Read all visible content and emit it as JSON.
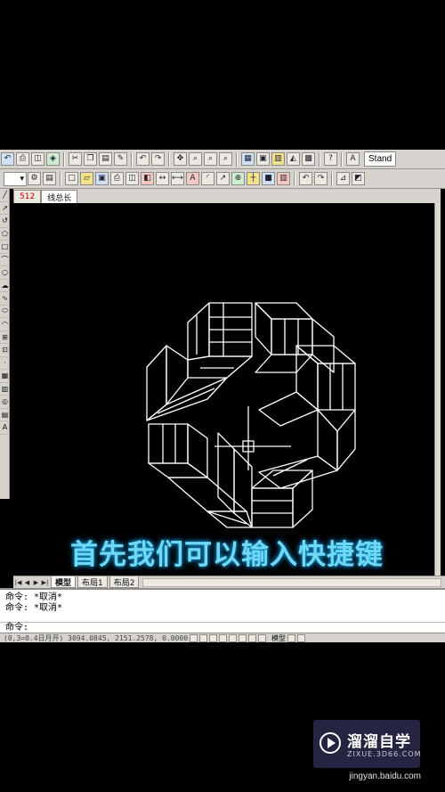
{
  "toolbar": {
    "text_style_value": "Stand",
    "row1_icons": [
      "undo-icon",
      "print-icon",
      "preview-icon",
      "publish-icon",
      "cut-icon",
      "copy-icon",
      "paste-icon",
      "matchprop-icon",
      "undo2-icon",
      "redo-icon",
      "pan-icon",
      "zoom-realtime-icon",
      "zoom-window-icon",
      "zoom-previous-icon",
      "properties-icon",
      "designcenter-icon",
      "toolpalette-icon",
      "markup-icon",
      "calculator-icon",
      "help-icon",
      "textstyle-icon"
    ],
    "row2_icons": [
      "layer-dropdown-icon",
      "layerprops-icon",
      "layerstate-icon",
      "new-icon",
      "open-icon",
      "save-icon",
      "plot-icon",
      "preview2-icon",
      "publish2-icon",
      "dimension-icon",
      "linear-dim-icon",
      "aligned-dim-icon",
      "radius-dim-icon",
      "leader-icon",
      "tolerance-icon",
      "center-mark-icon",
      "color-icon",
      "undo3-icon",
      "redo3-icon",
      "match-icon",
      "distance-icon"
    ]
  },
  "drawing_tabs": {
    "tab1": "512",
    "tab2": "线总长"
  },
  "left_tools": [
    "line",
    "construction-line",
    "polyline",
    "polygon",
    "rectangle",
    "arc",
    "circle",
    "revcloud",
    "spline",
    "ellipse",
    "ellipse-arc",
    "insert-block",
    "make-block",
    "point",
    "hatch",
    "gradient",
    "region",
    "table",
    "text"
  ],
  "left_tool_glyphs": [
    "╱",
    "↗",
    "↺",
    "⬠",
    "□",
    "⌒",
    "○",
    "☁",
    "∿",
    "⬭",
    "◠",
    "⊞",
    "⊡",
    "·",
    "▦",
    "▥",
    "◎",
    "▤",
    "A"
  ],
  "caption": "首先我们可以输入快捷键",
  "layout_tabs": {
    "model": "模型",
    "layout1": "布局1",
    "layout2": "布局2"
  },
  "command": {
    "line1": "命令: *取消*",
    "line2": "命令: *取消*",
    "prompt": "命令:"
  },
  "status": {
    "coords": "(0,3=0.4日月开)  3094.0845, 2151.2578, 0.0000",
    "model": "模型"
  },
  "watermark": {
    "title": "溜溜自学",
    "subtitle": "ZIXUE.3D66.COM",
    "site": "jingyan.baidu.com"
  },
  "colors": {
    "caption": "#6ed8f5",
    "drawing_lines": "#ffffff",
    "background": "#000000"
  }
}
